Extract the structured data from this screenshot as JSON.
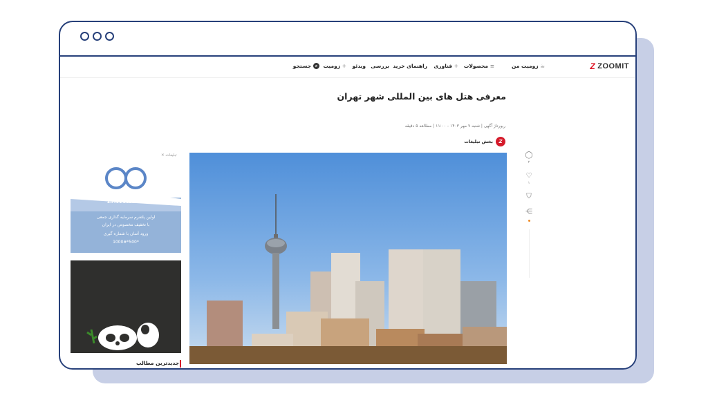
{
  "nav": {
    "logo": "ZOOMIT",
    "my_zoomit": "زومیت من",
    "products": "محصولات",
    "technology": "فناوری",
    "buying_guide": "راهنمای خرید",
    "review": "بررسی",
    "video": "ویدئو",
    "zoomit_plus": "زومیت",
    "search": "جستجو"
  },
  "article": {
    "title": "معرفی هتل های بین المللی شهر تهران",
    "meta": "رپورتاژ آگهی  |  شنبه ۷ مهر ۱۴۰۳ - ۱۱:۰۰  |  مطالعه ۵ دقیقه",
    "author_name": "بخش تبلیغات",
    "author_initial": "Z",
    "image_subject": "Tehran skyline with Milad Tower"
  },
  "actions": {
    "comments_count": "۲",
    "likes_count": "۱"
  },
  "ads": {
    "label": "تبلیغات",
    "ad1_brand": "Exfinito",
    "ad1_line1": "اولین پلتفرم سرمایه گذاری جمعی",
    "ad1_line2": "با تخفیف مخصوص در ایران",
    "ad1_line3": "ورود آسان با شماره گیری",
    "ad1_line4": "*500*1000#"
  },
  "sidebar": {
    "latest": "جدیدترین مطالب"
  },
  "colors": {
    "frame": "#27407a",
    "brand_red": "#d51b2b",
    "backplate": "#c7cfe6"
  }
}
